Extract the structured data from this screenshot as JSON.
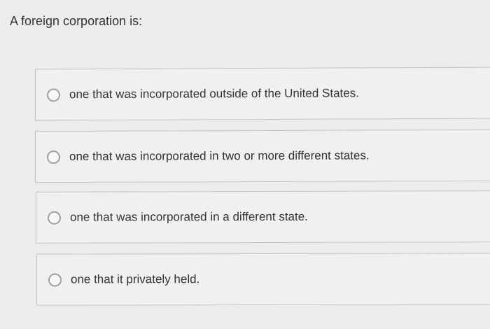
{
  "question": {
    "text": "A foreign corporation is:"
  },
  "options": [
    {
      "label": "one that was incorporated outside of the United States."
    },
    {
      "label": "one that was incorporated in two or more different states."
    },
    {
      "label": "one that was incorporated in a different state."
    },
    {
      "label": "one that it privately held."
    }
  ]
}
